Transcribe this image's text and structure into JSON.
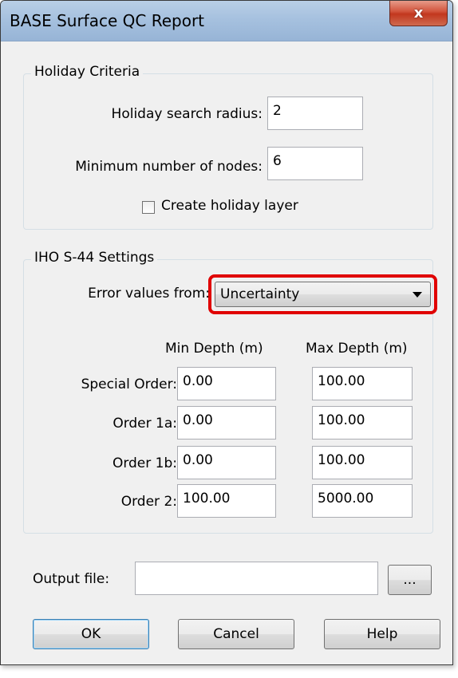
{
  "window": {
    "title": "BASE Surface QC Report",
    "close_label": "x"
  },
  "holiday": {
    "legend": "Holiday Criteria",
    "search_radius_label": "Holiday search radius:",
    "search_radius_value": "2",
    "min_nodes_label": "Minimum number of nodes:",
    "min_nodes_value": "6",
    "create_layer_label": "Create holiday layer",
    "create_layer_checked": false
  },
  "iho": {
    "legend": "IHO S-44 Settings",
    "error_values_label": "Error values from:",
    "error_values_selected": "Uncertainty",
    "col_min": "Min Depth (m)",
    "col_max": "Max Depth (m)",
    "rows": [
      {
        "label": "Special Order:",
        "min": "0.00",
        "max": "100.00"
      },
      {
        "label": "Order 1a:",
        "min": "0.00",
        "max": "100.00"
      },
      {
        "label": "Order 1b:",
        "min": "0.00",
        "max": "100.00"
      },
      {
        "label": "Order 2:",
        "min": "100.00",
        "max": "5000.00"
      }
    ]
  },
  "output": {
    "label": "Output file:",
    "value": "",
    "browse_label": "..."
  },
  "buttons": {
    "ok": "OK",
    "cancel": "Cancel",
    "help": "Help"
  },
  "colors": {
    "highlight": "#e00000",
    "default_button_border": "#3c7fb1"
  }
}
